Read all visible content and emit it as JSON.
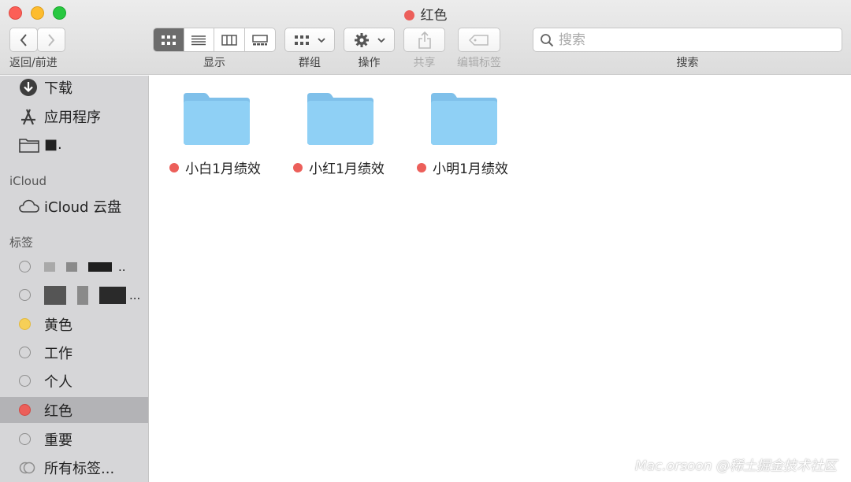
{
  "window": {
    "title": "红色",
    "title_tag_color": "#ec5f5a"
  },
  "toolbar": {
    "nav_label": "返回/前进",
    "view_label": "显示",
    "group_label": "群组",
    "action_label": "操作",
    "share_label": "共享",
    "tags_label": "编辑标签",
    "search_label": "搜索",
    "search_placeholder": "搜索",
    "active_view": "icon"
  },
  "sidebar": {
    "favorites": [
      {
        "label": "下载",
        "icon": "download-icon"
      },
      {
        "label": "应用程序",
        "icon": "applications-icon"
      },
      {
        "label": "■.",
        "icon": "folder-icon"
      }
    ],
    "icloud_header": "iCloud",
    "icloud_items": [
      {
        "label": "iCloud 云盘",
        "icon": "cloud-icon"
      }
    ],
    "tags_header": "标签",
    "tags": [
      {
        "label": "..",
        "color": "none",
        "redacted": true
      },
      {
        "label": "...",
        "color": "none",
        "redacted": true
      },
      {
        "label": "黄色",
        "color": "#f6cf57"
      },
      {
        "label": "工作",
        "color": "none"
      },
      {
        "label": "个人",
        "color": "none"
      },
      {
        "label": "红色",
        "color": "#ec5f5a",
        "selected": true
      },
      {
        "label": "重要",
        "color": "none"
      },
      {
        "label": "所有标签...",
        "color": "none"
      }
    ]
  },
  "content": {
    "items": [
      {
        "name": "小白1月绩效",
        "tag_color": "#ec5f5a"
      },
      {
        "name": "小红1月绩效",
        "tag_color": "#ec5f5a"
      },
      {
        "name": "小明1月绩效",
        "tag_color": "#ec5f5a"
      }
    ]
  },
  "watermark": "Mac.orsoon @稀土掘金技术社区"
}
